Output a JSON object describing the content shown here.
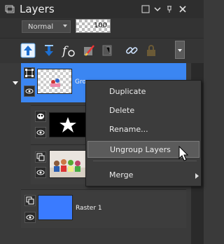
{
  "panel": {
    "title": "Layers",
    "icons": [
      "window-icon",
      "chevron-down-icon",
      "pin-icon",
      "close-icon"
    ]
  },
  "properties": {
    "blend_mode": "Normal",
    "opacity": "100"
  },
  "toolbar": {
    "icons": [
      "move-layer-up-icon",
      "move-layer-down-icon",
      "layer-properties-icon",
      "brush-edit-icon",
      "delete-layer-icon",
      "link-icon",
      "lock-icon",
      "more-dropdown-icon"
    ]
  },
  "layers": [
    {
      "name": "Gro",
      "selected": true
    },
    {
      "name": "",
      "selected": false
    },
    {
      "name": "",
      "selected": false
    },
    {
      "name": "Raster 1",
      "selected": false
    }
  ],
  "context_menu": {
    "items": [
      "Duplicate",
      "Delete",
      "Rename...",
      "Ungroup Layers",
      "Merge"
    ],
    "highlighted": "Ungroup Layers"
  },
  "colors": {
    "selection": "#3b86f2",
    "raster_fill": "#3a7bff"
  }
}
